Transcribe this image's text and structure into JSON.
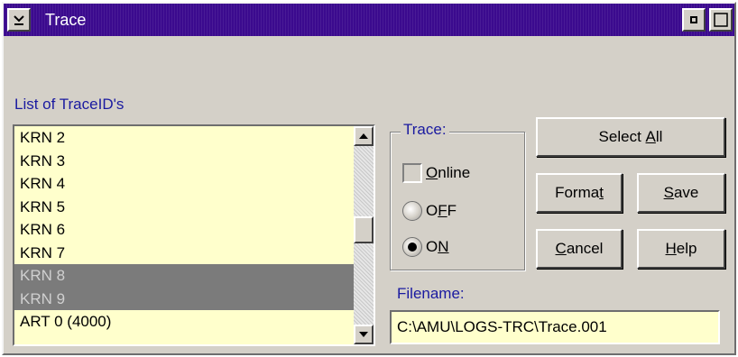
{
  "window": {
    "title": "Trace",
    "title_bar_color": "#3b0a8e"
  },
  "list": {
    "label": "List of TraceID's",
    "items": [
      {
        "text": "KRN 2",
        "selected": false
      },
      {
        "text": "KRN 3",
        "selected": false
      },
      {
        "text": "KRN 4",
        "selected": false
      },
      {
        "text": "KRN 5",
        "selected": false
      },
      {
        "text": "KRN 6",
        "selected": false
      },
      {
        "text": "KRN 7",
        "selected": false
      },
      {
        "text": "KRN 8",
        "selected": true
      },
      {
        "text": "KRN 9",
        "selected": true
      },
      {
        "text": "ART 0 (4000)",
        "selected": false
      }
    ],
    "background_color": "#ffffcc",
    "selected_color": "#7b7b7b"
  },
  "trace_group": {
    "label": "Trace:",
    "online": {
      "pre": "",
      "key": "O",
      "post": "nline",
      "checked": false
    },
    "off": {
      "pre": "O",
      "key": "F",
      "post": "F",
      "selected": false
    },
    "on": {
      "pre": "O",
      "key": "N",
      "post": "",
      "selected": true
    }
  },
  "buttons": {
    "select_all": {
      "pre": "Select ",
      "key": "A",
      "post": "ll"
    },
    "format": {
      "pre": "Forma",
      "key": "t",
      "post": ""
    },
    "save": {
      "pre": "",
      "key": "S",
      "post": "ave"
    },
    "cancel": {
      "pre": "",
      "key": "C",
      "post": "ancel"
    },
    "help": {
      "pre": "",
      "key": "H",
      "post": "elp"
    }
  },
  "filename": {
    "label": "Filename:",
    "value": "C:\\AMU\\LOGS-TRC\\Trace.001"
  },
  "icons": {
    "system_menu": "chevron-down-icon",
    "minimize": "minimize-icon",
    "maximize": "maximize-icon",
    "scroll_up": "arrow-up-icon",
    "scroll_down": "arrow-down-icon"
  },
  "label_color": "#1a1aa0"
}
